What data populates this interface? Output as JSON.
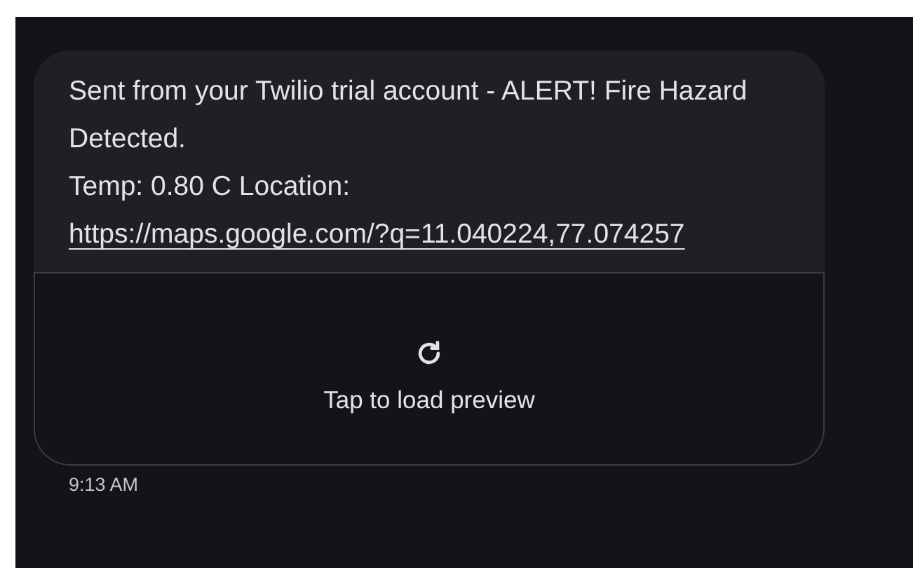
{
  "message": {
    "text": "Sent from your Twilio trial account - ALERT! Fire Hazard Detected.",
    "detail": "Temp: 0.80 C Location:",
    "link": "https://maps.google.com/?q=11.040224,77.074257"
  },
  "preview": {
    "label": "Tap to load preview"
  },
  "timestamp": "9:13 AM"
}
